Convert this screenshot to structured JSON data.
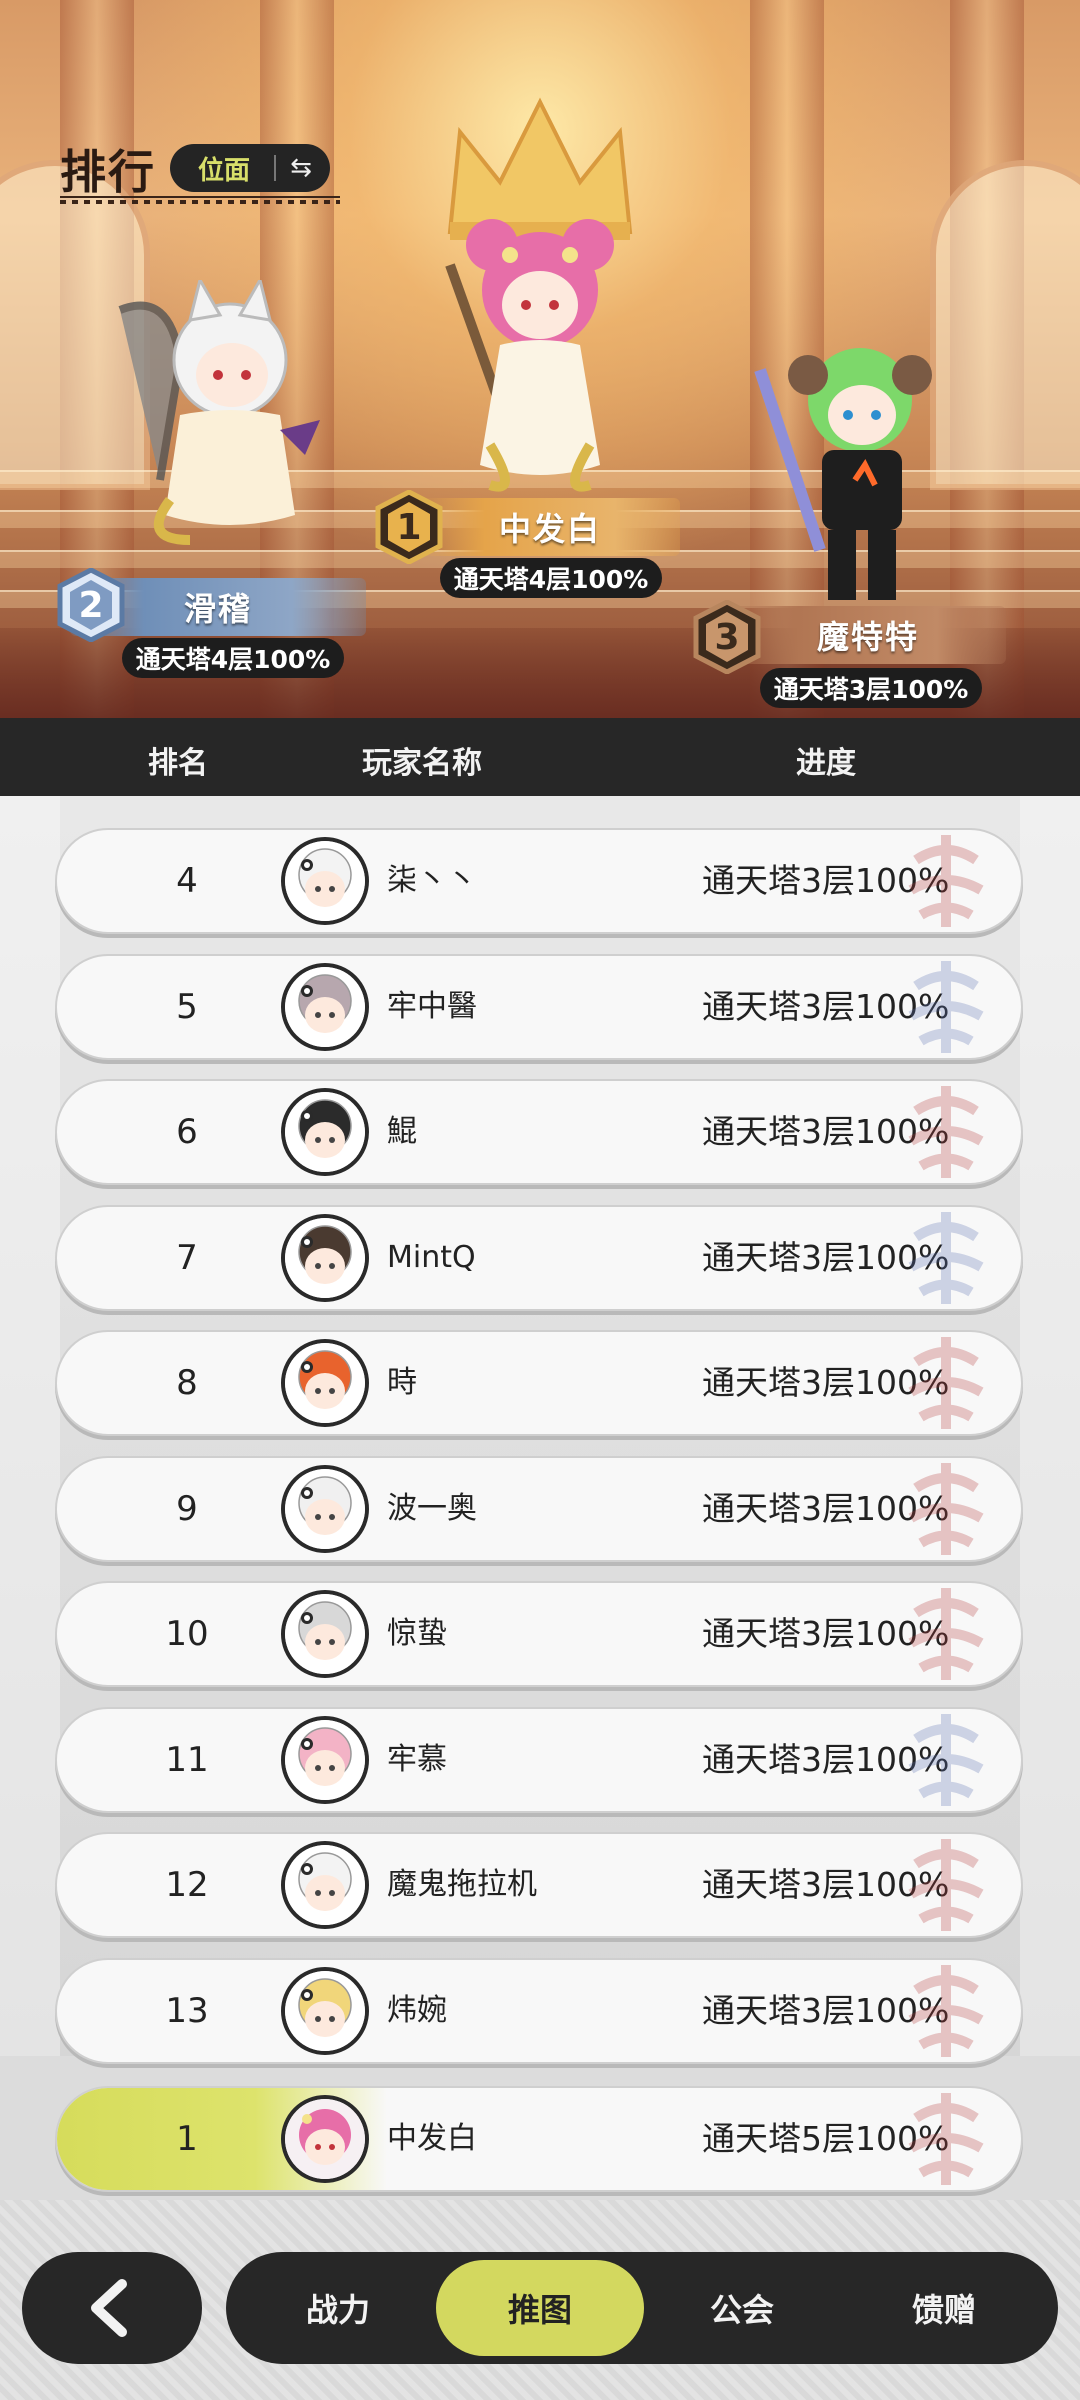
{
  "header": {
    "title": "排行",
    "switch_label": "位面",
    "swap_icon": "swap-icon"
  },
  "podium": [
    {
      "rank": "1",
      "name": "中发白",
      "progress": "通天塔4层100%",
      "plate_color": "#e5a44a"
    },
    {
      "rank": "2",
      "name": "滑稽",
      "progress": "通天塔4层100%",
      "plate_color": "#6f8fb8"
    },
    {
      "rank": "3",
      "name": "魔特特",
      "progress": "通天塔3层100%",
      "plate_color": "#b17653"
    }
  ],
  "table": {
    "col_rank": "排名",
    "col_name": "玩家名称",
    "col_progress": "进度"
  },
  "rows": [
    {
      "rank": "4",
      "name": "柒丶丶",
      "progress": "通天塔3层100%",
      "emblem": "red"
    },
    {
      "rank": "5",
      "name": "牢中醫",
      "progress": "通天塔3层100%",
      "emblem": "blue"
    },
    {
      "rank": "6",
      "name": "鯤",
      "progress": "通天塔3层100%",
      "emblem": "red"
    },
    {
      "rank": "7",
      "name": "MintQ",
      "progress": "通天塔3层100%",
      "emblem": "blue"
    },
    {
      "rank": "8",
      "name": "時",
      "progress": "通天塔3层100%",
      "emblem": "red"
    },
    {
      "rank": "9",
      "name": "波一奥",
      "progress": "通天塔3层100%",
      "emblem": "red"
    },
    {
      "rank": "10",
      "name": "惊蛰",
      "progress": "通天塔3层100%",
      "emblem": "red"
    },
    {
      "rank": "11",
      "name": "牢慕",
      "progress": "通天塔3层100%",
      "emblem": "blue"
    },
    {
      "rank": "12",
      "name": "魔鬼拖拉机",
      "progress": "通天塔3层100%",
      "emblem": "red"
    },
    {
      "rank": "13",
      "name": "炜婉",
      "progress": "通天塔3层100%",
      "emblem": "red"
    }
  ],
  "self_row": {
    "rank": "1",
    "name": "中发白",
    "progress": "通天塔5层100%"
  },
  "nav": {
    "back_icon": "back-arrow-icon",
    "tabs": [
      "战力",
      "推图",
      "公会",
      "馈赠"
    ],
    "active_tab": "推图"
  },
  "colors": {
    "accent": "#d3d85f",
    "dark": "#272727"
  }
}
